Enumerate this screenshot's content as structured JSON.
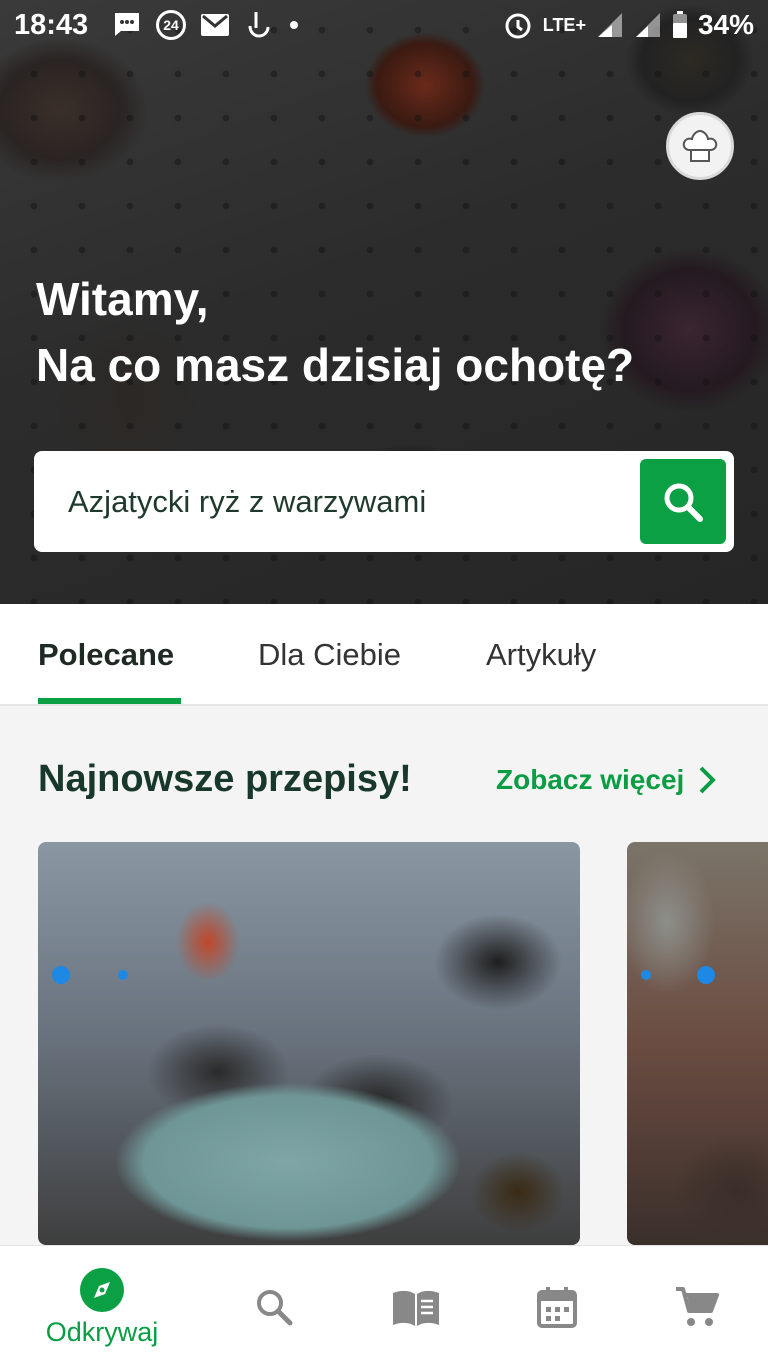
{
  "status_bar": {
    "time": "18:43",
    "badge_24": "24",
    "network": "LTE+",
    "battery": "34%"
  },
  "hero": {
    "greeting_line1": "Witamy,",
    "greeting_line2": "Na co masz dzisiaj ochotę?",
    "search_placeholder": "Azjatycki ryż z warzywami"
  },
  "tabs": [
    {
      "label": "Polecane",
      "active": true
    },
    {
      "label": "Dla Ciebie",
      "active": false
    },
    {
      "label": "Artykuły",
      "active": false
    }
  ],
  "section": {
    "title": "Najnowsze przepisy!",
    "see_more": "Zobacz więcej"
  },
  "bottom_nav": {
    "items": [
      {
        "icon": "compass-icon",
        "label": "Odkrywaj",
        "active": true
      },
      {
        "icon": "search-icon",
        "label": "",
        "active": false
      },
      {
        "icon": "book-icon",
        "label": "",
        "active": false
      },
      {
        "icon": "calendar-icon",
        "label": "",
        "active": false
      },
      {
        "icon": "cart-icon",
        "label": "",
        "active": false
      }
    ]
  },
  "colors": {
    "accent": "#0aa043",
    "heading": "#17382a"
  }
}
